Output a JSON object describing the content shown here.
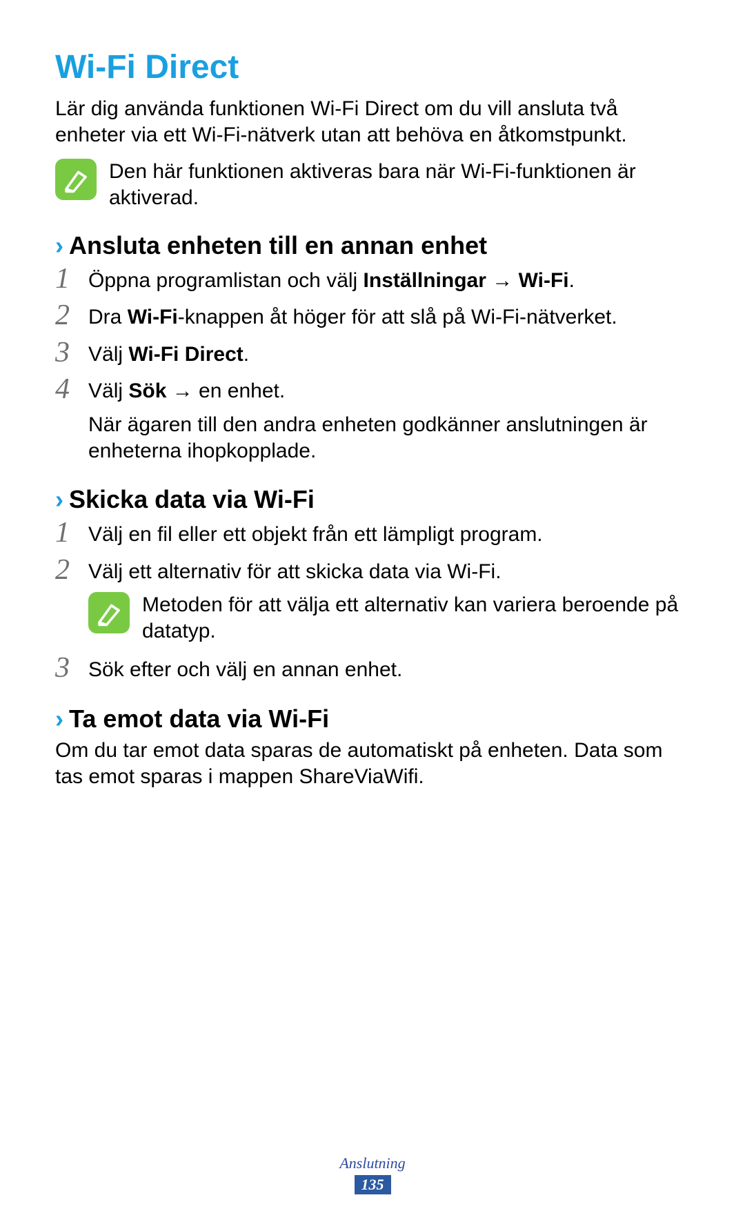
{
  "title": "Wi-Fi Direct",
  "intro": "Lär dig använda funktionen Wi-Fi Direct om du vill ansluta två enheter via ett Wi-Fi-nätverk utan att behöva en åtkomstpunkt.",
  "note1": "Den här funktionen aktiveras bara när Wi-Fi-funktionen är aktiverad.",
  "section1": {
    "heading": "Ansluta enheten till en annan enhet",
    "steps": {
      "s1": {
        "num": "1",
        "a": "Öppna programlistan och välj ",
        "b1": "Inställningar",
        "arrow": " → ",
        "b2": "Wi-Fi",
        "c": "."
      },
      "s2": {
        "num": "2",
        "a": "Dra ",
        "b": "Wi-Fi",
        "c": "-knappen åt höger för att slå på Wi-Fi-nätverket."
      },
      "s3": {
        "num": "3",
        "a": "Välj ",
        "b": "Wi-Fi Direct",
        "c": "."
      },
      "s4": {
        "num": "4",
        "a": "Välj ",
        "b": "Sök",
        "arrow": " → en enhet.",
        "sub": "När ägaren till den andra enheten godkänner anslutningen är enheterna ihopkopplade."
      }
    }
  },
  "section2": {
    "heading": "Skicka data via Wi-Fi",
    "steps": {
      "s1": {
        "num": "1",
        "text": "Välj en fil eller ett objekt från ett lämpligt program."
      },
      "s2": {
        "num": "2",
        "text": "Välj ett alternativ för att skicka data via Wi-Fi."
      }
    },
    "note": "Metoden för att välja ett alternativ kan variera beroende på datatyp.",
    "steps2": {
      "s3": {
        "num": "3",
        "text": "Sök efter och välj en annan enhet."
      }
    }
  },
  "section3": {
    "heading": "Ta emot data via Wi-Fi",
    "body": "Om du tar emot data sparas de automatiskt på enheten. Data som tas emot sparas i mappen ShareViaWifi."
  },
  "footer": {
    "section": "Anslutning",
    "page": "135"
  },
  "chevron": "›"
}
